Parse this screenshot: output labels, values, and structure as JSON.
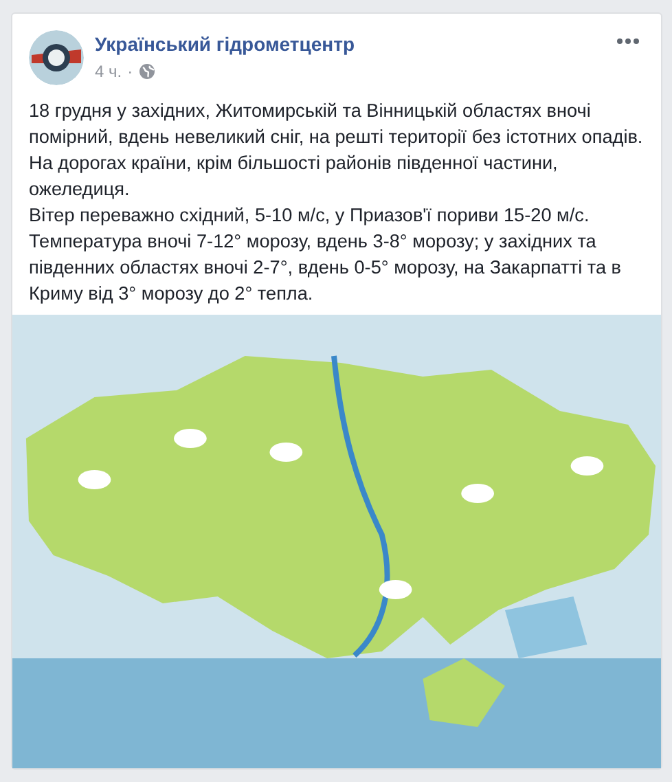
{
  "post": {
    "author": "Український гідрометцентр",
    "time": "4 ч.",
    "separator": "·",
    "paragraphs": [
      "18 грудня у західних, Житомирській та Вінницькій областях вночі помірний, вдень невеликий сніг, на решті території без істотних опадів.",
      "На дорогах країни, крім більшості районів південної частини, ожеледиця.",
      "Вітер переважно східний, 5-10 м/с, у Приазов'ї пориви 15-20 м/с. Температура вночі 7-12° морозу, вдень 3-8° морозу; у західних та південних областях вночі 2-7°, вдень 0-5° морозу, на Закарпатті та в Криму від 3° морозу до 2° тепла."
    ]
  }
}
